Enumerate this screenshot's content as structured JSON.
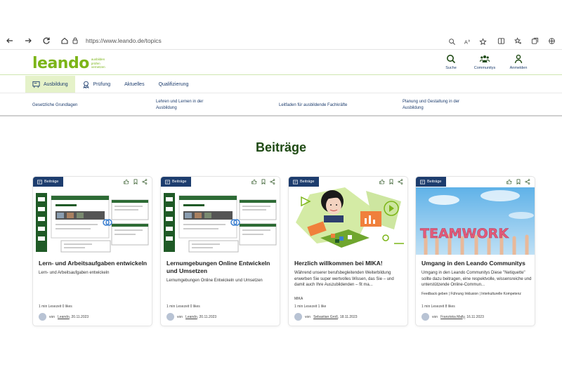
{
  "browser": {
    "url": "https://www.leando.de/topics"
  },
  "site": {
    "logo_word": "leando",
    "logo_tag": [
      "ausbilden",
      "prüfen",
      "vernetzen"
    ],
    "header_actions": [
      {
        "label": "Suche",
        "icon": "search-icon"
      },
      {
        "label": "Communitys",
        "icon": "community-icon"
      },
      {
        "label": "Anmelden",
        "icon": "user-icon"
      }
    ]
  },
  "main_nav": [
    {
      "label": "Ausbildung",
      "icon": "training-icon",
      "active": true
    },
    {
      "label": "Prüfung",
      "icon": "award-icon"
    },
    {
      "label": "Aktuelles"
    },
    {
      "label": "Qualifizierung"
    }
  ],
  "sub_nav": [
    "Gesetzliche Grundlagen",
    "Lehren und Lernen in der Ausbildung",
    "Leitfaden für ausbildende Fachkräfte",
    "Planung und Gestaltung in der Ausbildung"
  ],
  "section": {
    "title": "Beiträge"
  },
  "cards": [
    {
      "badge": "Beiträge",
      "title": "Lern- und Arbeitsaufgaben entwickeln",
      "desc": "Lern- und Arbeitsaufgaben entwickeln",
      "tags": "",
      "meta": "1 min Lesezeit   0 likes",
      "by": "von",
      "author": "Leando",
      "date": ", 20.11.2023"
    },
    {
      "badge": "Beiträge",
      "title": "Lernumgebungen Online Entwickeln und Umsetzen",
      "desc": "Lernumgebungen Online Entwickeln und Umsetzen",
      "tags": "",
      "meta": "1 min Lesezeit   0 likes",
      "by": "von",
      "author": "Leando",
      "date": ", 20.11.2023"
    },
    {
      "badge": "Beiträge",
      "title": "Herzlich willkommen bei MIKA!",
      "desc": "Während unserer berufsbegleitenden Weiterbildung erwerben Sie super wertvolles Wissen, das Sie – und damit auch Ihre Auszubildenden – fit ma...",
      "tags": "MIKA",
      "meta": "1 min Lesezeit   1 like",
      "by": "von",
      "author": "Sebastian Groß",
      "date": ", 18.11.2023"
    },
    {
      "badge": "Beiträge",
      "title": "Umgang in den Leando Communitys",
      "desc": "Umgang in den Leando Communitys Diese \"Netiquette\" sollte dazu beitragen, eine respektvolle, wissensreiche und unterstützende Online-Commun...",
      "tags": "Feedback geben | Führung   Inklusion | Interkulturelle Kompetenz",
      "meta": "1 min Lesezeit   8 likes",
      "by": "von",
      "author": "Franziska Mally",
      "date": ", 16.11.2023"
    }
  ],
  "image_texts": {
    "teamwork": "TEAMWORK"
  },
  "colors": {
    "brand_green": "#7cb518",
    "navy": "#1d3d6e",
    "title_green": "#1f4a14",
    "active_nav_bg": "#e5f2c9"
  }
}
